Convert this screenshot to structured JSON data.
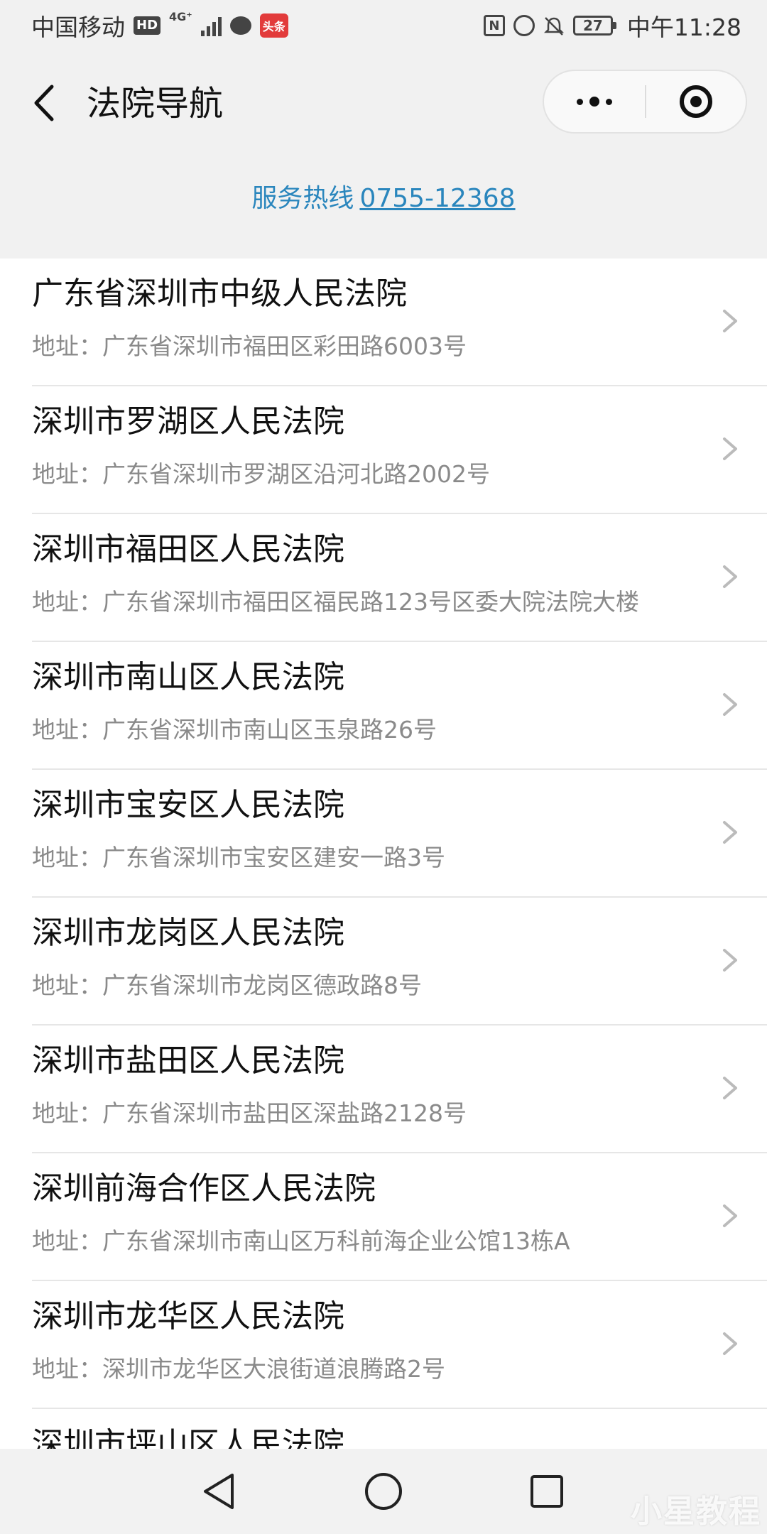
{
  "status_bar": {
    "carrier": "中国移动",
    "hd": "HD",
    "network": "4G⁺",
    "app_badge": "头条",
    "nfc": "N",
    "battery": "27",
    "time": "中午11:28"
  },
  "nav": {
    "title": "法院导航"
  },
  "hotline": {
    "label": "服务热线",
    "number": "0755-12368"
  },
  "courts": [
    {
      "name": "广东省深圳市中级人民法院",
      "address": "地址：广东省深圳市福田区彩田路6003号"
    },
    {
      "name": "深圳市罗湖区人民法院",
      "address": "地址：广东省深圳市罗湖区沿河北路2002号"
    },
    {
      "name": "深圳市福田区人民法院",
      "address": "地址：广东省深圳市福田区福民路123号区委大院法院大楼"
    },
    {
      "name": "深圳市南山区人民法院",
      "address": "地址：广东省深圳市南山区玉泉路26号"
    },
    {
      "name": "深圳市宝安区人民法院",
      "address": "地址：广东省深圳市宝安区建安一路3号"
    },
    {
      "name": "深圳市龙岗区人民法院",
      "address": "地址：广东省深圳市龙岗区德政路8号"
    },
    {
      "name": "深圳市盐田区人民法院",
      "address": "地址：广东省深圳市盐田区深盐路2128号"
    },
    {
      "name": "深圳前海合作区人民法院",
      "address": "地址：广东省深圳市南山区万科前海企业公馆13栋A"
    },
    {
      "name": "深圳市龙华区人民法院",
      "address": "地址：深圳市龙华区大浪街道浪腾路2号"
    },
    {
      "name": "深圳市坪山区人民法院",
      "address": ""
    }
  ],
  "watermark": "小星教程",
  "colors": {
    "link": "#2a86bd",
    "address": "#8a8a8a",
    "background": "#f1f1f1"
  }
}
